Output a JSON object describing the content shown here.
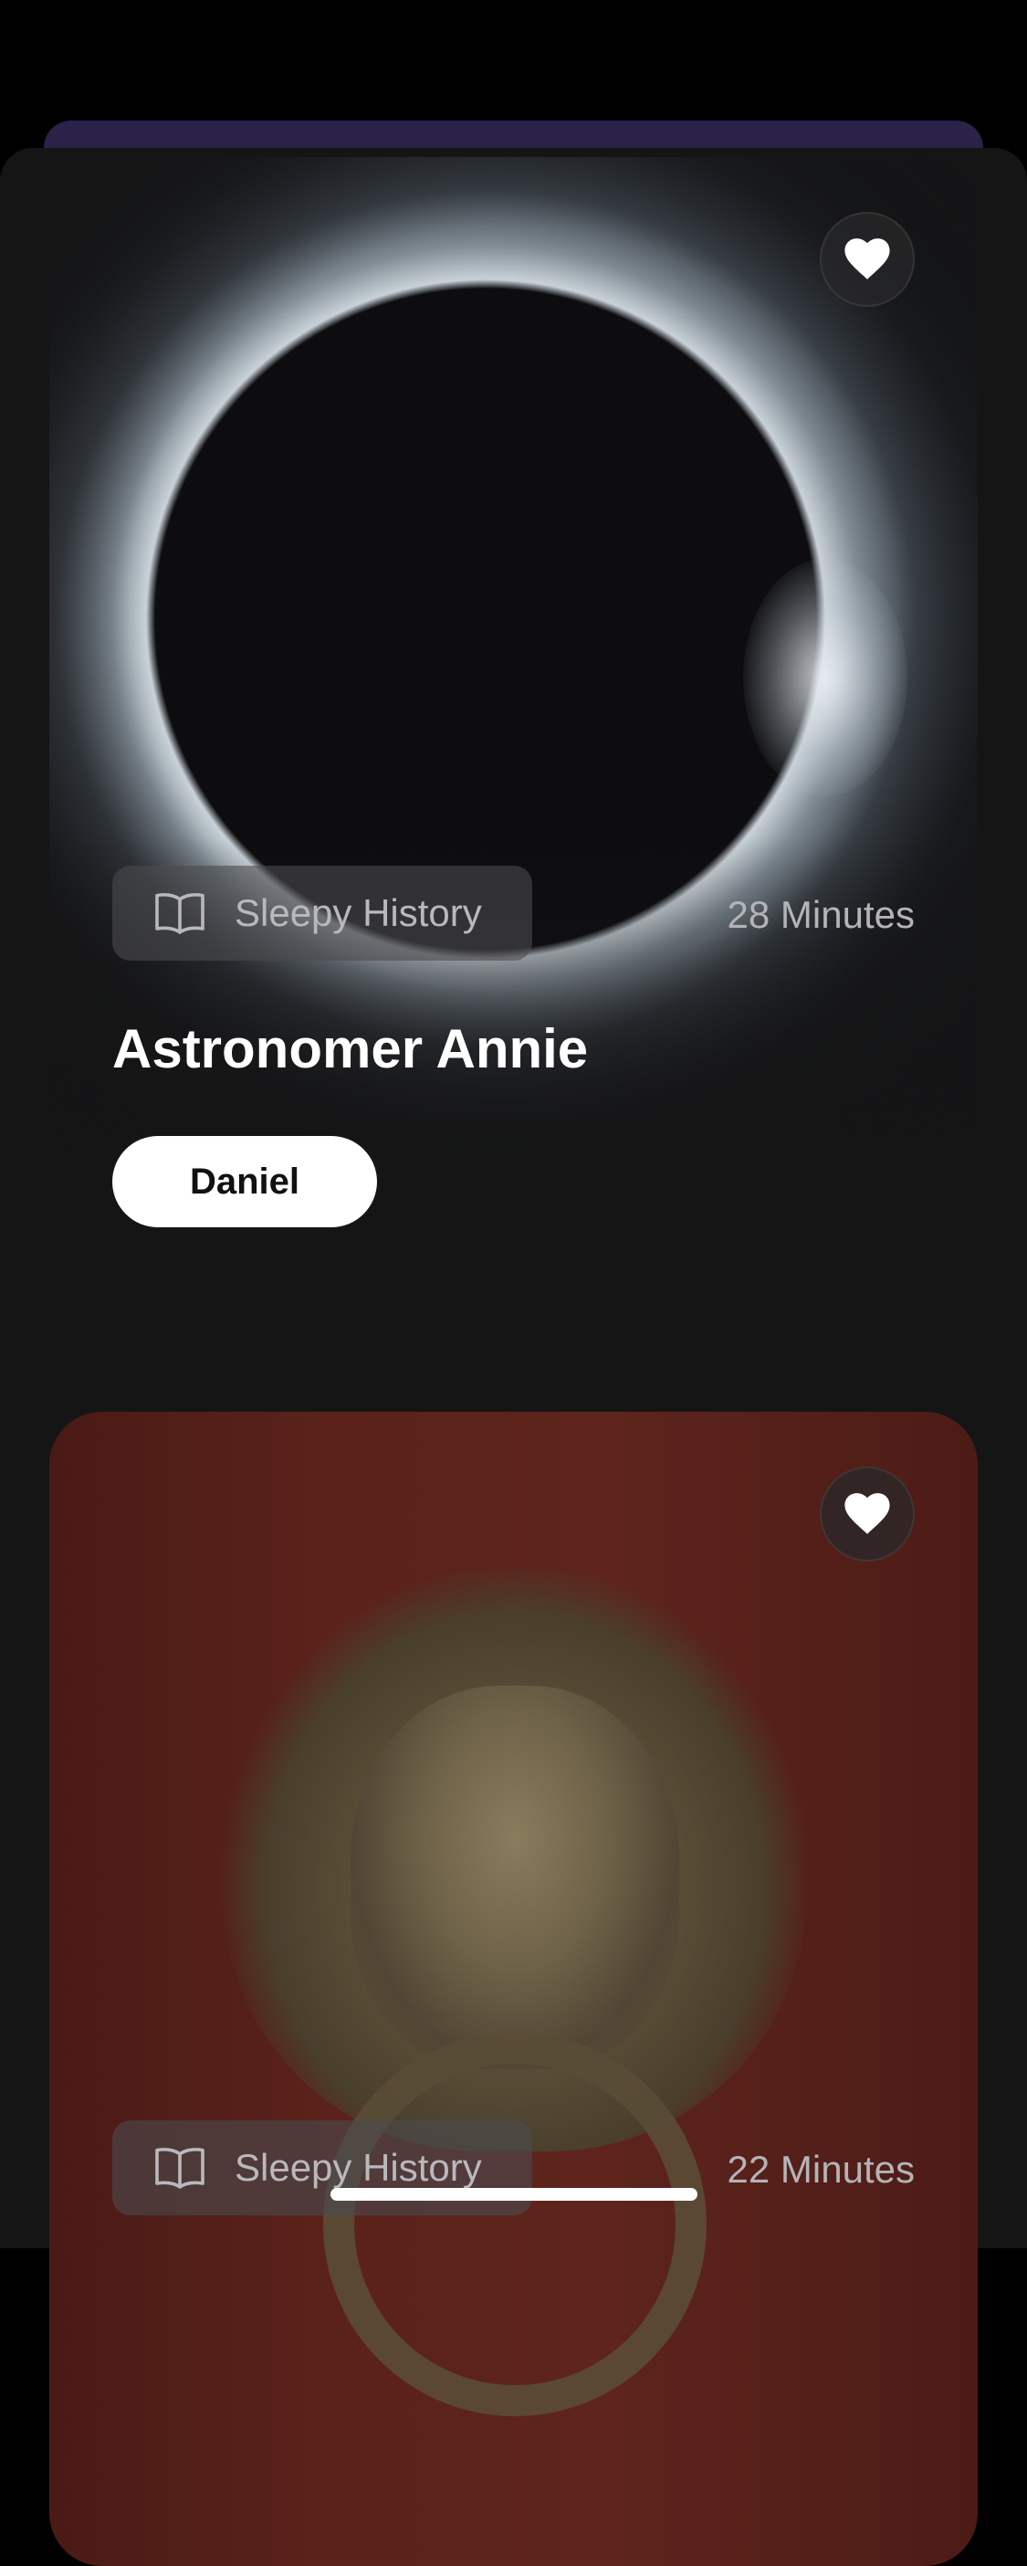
{
  "feed": {
    "cards": [
      {
        "category": "Sleepy History",
        "duration": "28 Minutes",
        "title": "Astronomer Annie",
        "narrator": "Daniel",
        "favorite_icon": "heart-icon",
        "category_icon": "book-open-icon"
      },
      {
        "category": "Sleepy History",
        "duration": "22 Minutes",
        "favorite_icon": "heart-icon",
        "category_icon": "book-open-icon"
      }
    ]
  },
  "colors": {
    "background": "#151516",
    "accent_sheet": "#2a2249",
    "chip": "#4b4b4e",
    "text_primary": "#ffffff",
    "text_secondary": "#b4b4b7"
  }
}
